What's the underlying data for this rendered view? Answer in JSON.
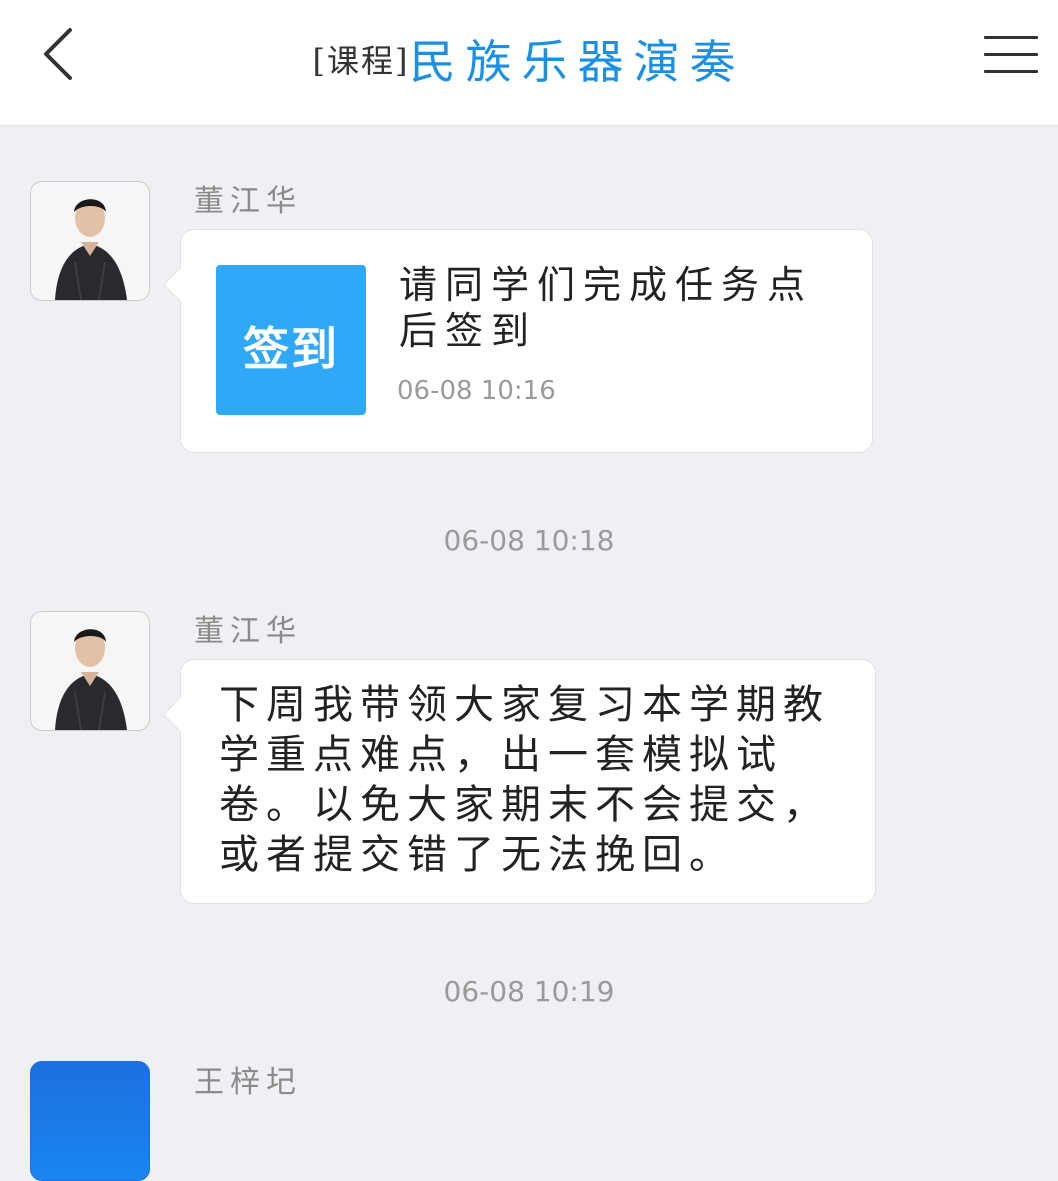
{
  "header": {
    "title_prefix": "[课程]",
    "title": "民族乐器演奏",
    "back_icon": "chevron-left-icon",
    "menu_icon": "hamburger-menu-icon",
    "accent_color": "#1a8fe8"
  },
  "messages": [
    {
      "sender": "董江华",
      "type": "sign-in",
      "tile_label": "签到",
      "tile_color": "#2fa8f8",
      "text": "请同学们完成任务点后签到",
      "time": "06-08 10:16"
    },
    {
      "sender": "董江华",
      "type": "text",
      "text": "下周我带领大家复习本学期教学重点难点，出一套模拟试卷。以免大家期末不会提交，或者提交错了无法挽回。"
    },
    {
      "sender": "王梓圮",
      "type": "text"
    }
  ],
  "timestamps": [
    "06-08 10:18",
    "06-08 10:19"
  ]
}
